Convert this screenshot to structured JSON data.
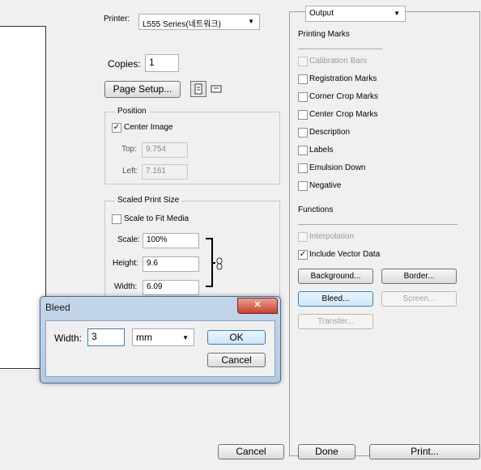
{
  "printer": {
    "label": "Printer:",
    "value": "L555 Series(네트워크)"
  },
  "copies": {
    "label": "Copies:",
    "value": "1"
  },
  "page_setup_label": "Page Setup...",
  "position": {
    "title": "Position",
    "center_image_label": "Center Image",
    "top_label": "Top:",
    "top_value": "9.754",
    "left_label": "Left:",
    "left_value": "7.161"
  },
  "scaled": {
    "title": "Scaled Print Size",
    "scale_to_fit_label": "Scale to Fit Media",
    "scale_label": "Scale:",
    "scale_value": "100%",
    "height_label": "Height:",
    "height_value": "9.6",
    "width_label": "Width:",
    "width_value": "6.09"
  },
  "output": {
    "dropdown": "Output",
    "printing_marks_title": "Printing Marks",
    "marks": [
      {
        "label": "Calibration Bars",
        "checked": false,
        "disabled": true
      },
      {
        "label": "Registration Marks",
        "checked": false,
        "disabled": false
      },
      {
        "label": "Corner Crop Marks",
        "checked": false,
        "disabled": false
      },
      {
        "label": "Center Crop Marks",
        "checked": false,
        "disabled": false
      },
      {
        "label": "Description",
        "checked": false,
        "disabled": false
      },
      {
        "label": "Labels",
        "checked": false,
        "disabled": false
      },
      {
        "label": "Emulsion Down",
        "checked": false,
        "disabled": false
      },
      {
        "label": "Negative",
        "checked": false,
        "disabled": false
      }
    ],
    "functions_title": "Functions",
    "interpolation_label": "Interpolation",
    "include_vector_label": "Include Vector Data",
    "background_label": "Background...",
    "border_label": "Border...",
    "bleed_label": "Bleed...",
    "screen_label": "Screen...",
    "transfer_label": "Transfer..."
  },
  "bleed_dialog": {
    "title": "Bleed",
    "close": "✕",
    "width_label": "Width:",
    "width_value": "3",
    "unit": "mm",
    "ok_label": "OK",
    "cancel_label": "Cancel"
  },
  "footer": {
    "cancel_label": "Cancel",
    "done_label": "Done",
    "print_label": "Print..."
  }
}
